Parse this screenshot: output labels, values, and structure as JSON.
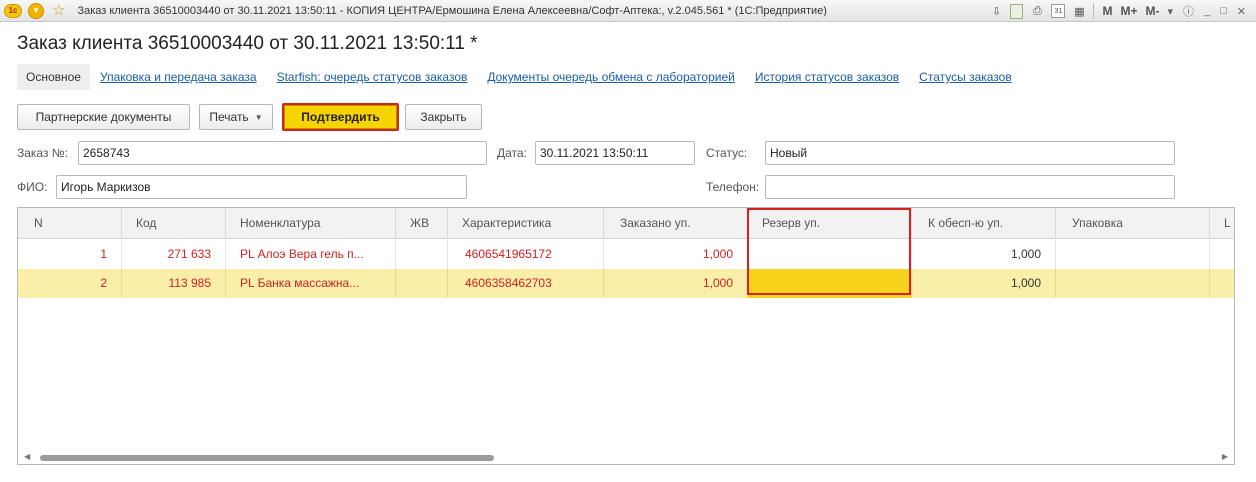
{
  "window": {
    "title": "Заказ клиента 36510003440 от 30.11.2021 13:50:11 - КОПИЯ ЦЕНТРА/Ермошина Елена Алексеевна/Софт-Аптека:, v.2.045.561 *  (1С:Предприятие)",
    "logo": "1с",
    "controls": {
      "m": "M",
      "m_plus": "M+",
      "m_minus": "M-"
    }
  },
  "heading": "Заказ клиента 36510003440 от 30.11.2021 13:50:11 *",
  "tabs": [
    {
      "label": "Основное",
      "active": true
    },
    {
      "label": "Упаковка и передача заказа"
    },
    {
      "label": "Starfish: очередь статусов заказов"
    },
    {
      "label": "Документы очередь обмена с лабораторией"
    },
    {
      "label": "История статусов заказов"
    },
    {
      "label": "Статусы заказов"
    }
  ],
  "toolbar": {
    "partner_docs": "Партнерские документы",
    "print": "Печать",
    "confirm": "Подтвердить",
    "close": "Закрыть"
  },
  "form": {
    "order_label": "Заказ №:",
    "order_value": "2658743",
    "date_label": "Дата:",
    "date_value": "30.11.2021 13:50:11",
    "status_label": "Статус:",
    "status_value": "Новый",
    "fio_label": "ФИО:",
    "fio_value": "Игорь Маркизов",
    "phone_label": "Телефон:",
    "phone_value": ""
  },
  "table": {
    "columns": [
      "N",
      "Код",
      "Номенклатура",
      "ЖВ",
      "Характеристика",
      "Заказано уп.",
      "Резерв уп.",
      "К обесп-ю уп.",
      "Упаковка",
      "L"
    ],
    "rows": [
      {
        "n": "1",
        "code": "271 633",
        "name": "PL Алоэ Вера гель п...",
        "zhv": "",
        "char": "4606541965172",
        "ordered": "1,000",
        "reserve": "",
        "to_provide": "1,000",
        "pack": ""
      },
      {
        "n": "2",
        "code": "113 985",
        "name": "PL Банка массажна...",
        "zhv": "",
        "char": "4606358462703",
        "ordered": "1,000",
        "reserve": "",
        "to_provide": "1,000",
        "pack": ""
      }
    ]
  },
  "colors": {
    "accent_yellow": "#f5d400",
    "highlight_red": "#d42222",
    "row_text_red": "#cc2222",
    "link_blue": "#1c5caa",
    "selected_row": "#faefa8"
  }
}
